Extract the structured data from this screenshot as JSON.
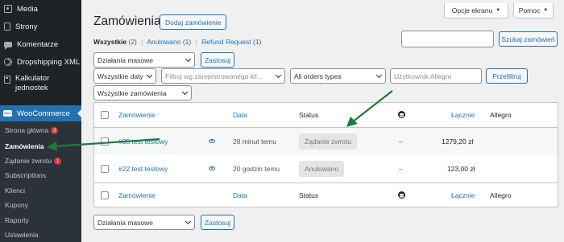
{
  "sidebar": {
    "items": [
      {
        "label": "Media",
        "icon": "media-icon"
      },
      {
        "label": "Strony",
        "icon": "pages-icon"
      },
      {
        "label": "Komentarze",
        "icon": "comments-icon"
      },
      {
        "label": "Dropshipping XML",
        "icon": "dropshipping-icon"
      },
      {
        "label_line1": "Kalkulator",
        "label_line2": "jednostek",
        "icon": "calculator-icon"
      }
    ],
    "active": {
      "label": "WooCommerce",
      "logo_text": "Woo"
    },
    "submenu": [
      {
        "label": "Strona główna",
        "badge": "3"
      },
      {
        "label": "Zamówienia"
      },
      {
        "label": "Żądanie zwrotu",
        "badge": "1"
      },
      {
        "label": "Subscriptions"
      },
      {
        "label": "Klienci"
      },
      {
        "label": "Kupony"
      },
      {
        "label": "Raporty"
      },
      {
        "label": "Ustawienia"
      }
    ]
  },
  "header": {
    "screen_options": "Opcje ekranu",
    "help": "Pomoc",
    "title": "Zamówienia",
    "add_button": "Dodaj zamówienie"
  },
  "views": {
    "all": "Wszystkie",
    "all_count": "(2)",
    "cancelled": "Anulowano",
    "cancelled_count": "(1)",
    "refund": "Refund Request",
    "refund_count": "(1)"
  },
  "search": {
    "value": "",
    "button": "Szukaj zamówień"
  },
  "filters": {
    "bulk_actions": "Działania masowe",
    "apply": "Zastosuj",
    "dates": "Wszystkie daty",
    "user_filter_placeholder": "Filtruj wg zarejestrowanego kli...",
    "order_types": "All orders types",
    "allegro_user_placeholder": "Użytkownik Allegro",
    "filter_button": "Przefiltruj",
    "all_orders": "Wszystkie zamówienia"
  },
  "table": {
    "columns": {
      "order": "Zamówienie",
      "date": "Data",
      "status": "Status",
      "total": "Łącznie",
      "allegro": "Allegro"
    },
    "rows": [
      {
        "order": "#35 test testowy",
        "date": "28 minut temu",
        "status": "Żądanie zwrotu",
        "dash": "–",
        "total": "1279,20 zł"
      },
      {
        "order": "#22 test testowy",
        "date": "20 godzin temu",
        "status": "Anulowano",
        "dash": "–",
        "total": "123,00 zł"
      }
    ]
  },
  "bottom": {
    "bulk_actions": "Działania masowe",
    "apply": "Zastosuj"
  },
  "colors": {
    "accent": "#2271b1",
    "sidebar_bg": "#1d2327",
    "badge": "#d63638",
    "annotation_arrow": "#1e7a3a"
  }
}
